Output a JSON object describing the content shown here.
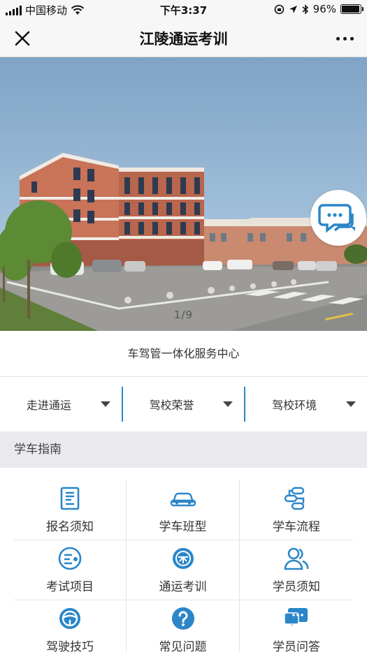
{
  "status_bar": {
    "carrier": "中国移动",
    "time": "下午3:37",
    "battery_text": "96%",
    "battery_level": 0.96
  },
  "nav": {
    "title": "江陵通运考训"
  },
  "banner": {
    "slide_counter": "1/9"
  },
  "subtitle": "车驾管一体化服务中心",
  "tabs": [
    {
      "label": "走进通运"
    },
    {
      "label": "驾校荣誉"
    },
    {
      "label": "驾校环境"
    }
  ],
  "section": {
    "title": "学车指南"
  },
  "grid": [
    {
      "label": "报名须知",
      "icon": "document-icon"
    },
    {
      "label": "学车班型",
      "icon": "car-icon"
    },
    {
      "label": "学车流程",
      "icon": "flow-icon"
    },
    {
      "label": "考试项目",
      "icon": "exam-icon"
    },
    {
      "label": "通运考训",
      "icon": "logo-badge-icon"
    },
    {
      "label": "学员须知",
      "icon": "users-icon"
    },
    {
      "label": "驾驶技巧",
      "icon": "steering-wheel-icon"
    },
    {
      "label": "常见问题",
      "icon": "question-icon"
    },
    {
      "label": "学员问答",
      "icon": "chat-icon"
    }
  ],
  "colors": {
    "accent": "#2a86c8",
    "section_bg": "#e9e9ee",
    "nav_bg": "#f7f7f7"
  }
}
